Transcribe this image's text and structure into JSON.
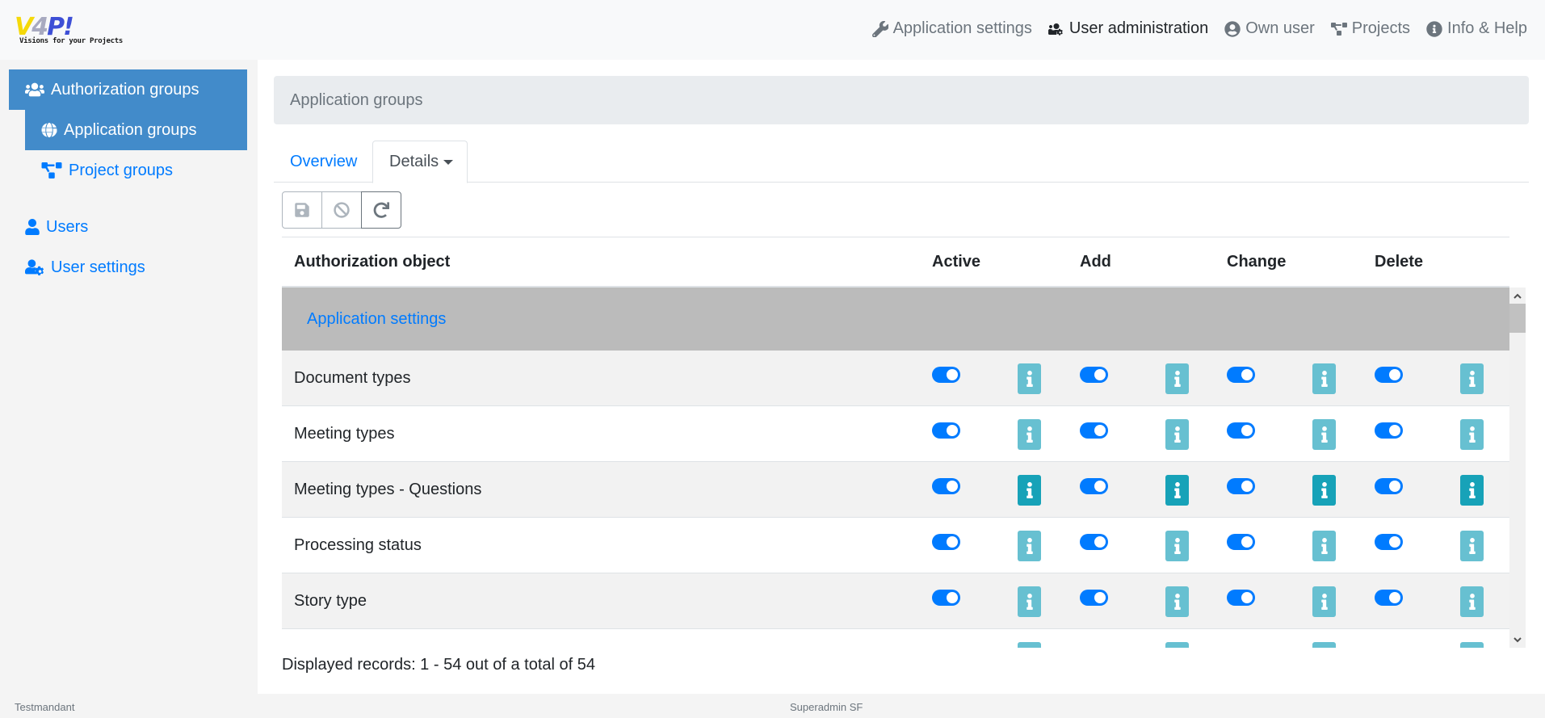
{
  "logo": {
    "mark_v": "V",
    "mark_4": "4",
    "mark_p": "P!",
    "tagline": "Visions for your Projects"
  },
  "topnav": [
    {
      "label": "Application settings",
      "icon": "wrench-icon",
      "active": false
    },
    {
      "label": "User administration",
      "icon": "users-cog-icon",
      "active": true
    },
    {
      "label": "Own user",
      "icon": "user-circle-icon",
      "active": false
    },
    {
      "label": "Projects",
      "icon": "project-diagram-icon",
      "active": false
    },
    {
      "label": "Info & Help",
      "icon": "info-circle-icon",
      "active": false
    }
  ],
  "sidebar": {
    "items": [
      {
        "label": "Authorization groups",
        "icon": "users-icon",
        "active": true
      },
      {
        "label": "Application groups",
        "icon": "globe-icon",
        "active": true
      },
      {
        "label": "Project groups",
        "icon": "project-diagram-icon",
        "active": false
      },
      {
        "label": "Users",
        "icon": "user-icon",
        "active": false
      },
      {
        "label": "User settings",
        "icon": "user-cog-icon",
        "active": false
      }
    ]
  },
  "page": {
    "header": "Application groups"
  },
  "tabs": {
    "overview": "Overview",
    "details": "Details"
  },
  "toolbar": {
    "save": "save-icon",
    "cancel": "ban-icon",
    "reload": "redo-icon"
  },
  "table": {
    "columns": {
      "object": "Authorization object",
      "active": "Active",
      "add": "Add",
      "change": "Change",
      "delete": "Delete"
    },
    "group": "Application settings",
    "rows": [
      {
        "label": "Document types",
        "active": true,
        "add": true,
        "change": true,
        "delete": true,
        "info_highlight": false
      },
      {
        "label": "Meeting types",
        "active": true,
        "add": true,
        "change": true,
        "delete": true,
        "info_highlight": false
      },
      {
        "label": "Meeting types - Questions",
        "active": true,
        "add": true,
        "change": true,
        "delete": true,
        "info_highlight": true
      },
      {
        "label": "Processing status",
        "active": true,
        "add": true,
        "change": true,
        "delete": true,
        "info_highlight": false
      },
      {
        "label": "Story type",
        "active": true,
        "add": true,
        "change": true,
        "delete": true,
        "info_highlight": false
      }
    ]
  },
  "records": "Displayed records: 1 - 54 out of a total of 54",
  "footer": {
    "tenant": "Testmandant",
    "user": "Superadmin SF"
  },
  "colors": {
    "primary": "#007bff",
    "sidebar_active": "#428bca",
    "info": "#67c0d1",
    "info_strong": "#17a2b8",
    "group_row": "#bbbbbb"
  }
}
